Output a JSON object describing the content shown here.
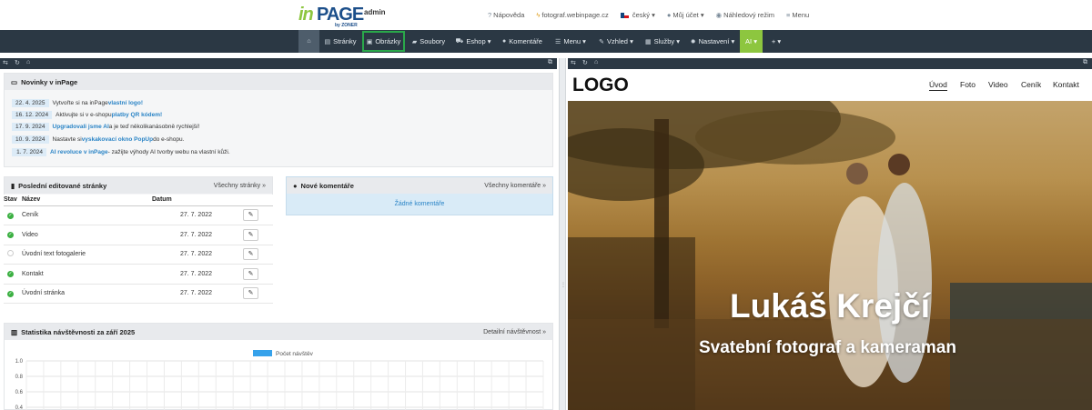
{
  "header": {
    "logo_in": "in",
    "logo_page": "PAGE",
    "logo_by": "by ZONER",
    "logo_admin": "admin",
    "links": [
      {
        "icon": "help-icon",
        "label": "Nápověda"
      },
      {
        "icon": "bolt-icon",
        "label": "fotograf.webinpage.cz"
      },
      {
        "icon": "flag-cz-icon",
        "label": "český ▾"
      },
      {
        "icon": "user-icon",
        "label": "Můj účet ▾"
      },
      {
        "icon": "eye-icon",
        "label": "Náhledový režim"
      },
      {
        "icon": "menu-icon",
        "label": "Menu"
      }
    ]
  },
  "nav": {
    "items": [
      {
        "label": "",
        "icon": "home-icon"
      },
      {
        "label": "Stránky",
        "icon": "page-icon"
      },
      {
        "label": "Obrázky",
        "icon": "image-icon"
      },
      {
        "label": "Soubory",
        "icon": "folder-icon"
      },
      {
        "label": "Eshop ▾",
        "icon": "cart-icon"
      },
      {
        "label": "Komentáře",
        "icon": "comment-icon"
      },
      {
        "label": "Menu ▾",
        "icon": "list-icon"
      },
      {
        "label": "Vzhled ▾",
        "icon": "brush-icon"
      },
      {
        "label": "Služby ▾",
        "icon": "grid-icon"
      },
      {
        "label": "Nastavení ▾",
        "icon": "gear-icon"
      },
      {
        "label": "AI ▾",
        "icon": ""
      },
      {
        "label": "+ ▾",
        "icon": ""
      }
    ],
    "colors": {
      "bar": "#2b3844",
      "active": "#4e5d6b",
      "ai": "#8dc63f",
      "highlight": "#2aa84a"
    }
  },
  "news": {
    "title": "Novinky v inPage",
    "items": [
      {
        "date": "22. 4. 2025",
        "pre": "Vytvořte si na inPage ",
        "bold": "vlastní logo!",
        "post": ""
      },
      {
        "date": "16. 12. 2024",
        "pre": "Aktivujte si v e-shopu ",
        "bold": "platby QR kódem!",
        "post": ""
      },
      {
        "date": "17. 9. 2024",
        "pre": "",
        "bold": "Upgradovali jsme AI",
        "post": " a je teď několikanásobně rychlejší!"
      },
      {
        "date": "10. 9. 2024",
        "pre": "Nastavte si ",
        "bold": "vyskakovací okno PopUp",
        "post": " do e-shopu."
      },
      {
        "date": "1. 7. 2024",
        "pre": "",
        "bold": "AI revoluce v inPage",
        "post": " - zažijte výhody AI tvorby webu na vlastní kůži."
      }
    ]
  },
  "pages": {
    "title": "Poslední editované stránky",
    "all_link": "Všechny stránky »",
    "col_status": "Stav",
    "col_name": "Název",
    "col_date": "Datum",
    "rows": [
      {
        "ok": true,
        "name": "Ceník",
        "date": "27. 7. 2022"
      },
      {
        "ok": true,
        "name": "Video",
        "date": "27. 7. 2022"
      },
      {
        "ok": false,
        "name": "Úvodní text fotogalerie",
        "date": "27. 7. 2022"
      },
      {
        "ok": true,
        "name": "Kontakt",
        "date": "27. 7. 2022"
      },
      {
        "ok": true,
        "name": "Úvodní stránka",
        "date": "27. 7. 2022"
      }
    ]
  },
  "comments": {
    "title": "Nové komentáře",
    "all_link": "Všechny komentáře »",
    "empty": "Žádné komentáře"
  },
  "stats": {
    "title": "Statistika návštěvnosti za září 2025",
    "detail_link": "Detailní návštěvnost »",
    "legend": "Počet návštěv",
    "legend_color": "#36a2eb",
    "ticks": [
      "1.0",
      "0.8",
      "0.6",
      "0.4"
    ]
  },
  "chart_data": {
    "type": "line",
    "series": [
      {
        "name": "Počet návštěv",
        "values": []
      }
    ],
    "ylim": [
      0,
      1
    ],
    "grid": true,
    "legend": "top"
  },
  "site": {
    "logo": "LOGO",
    "menu": [
      "Úvod",
      "Foto",
      "Video",
      "Ceník",
      "Kontakt"
    ],
    "headline": "Lukáš Krejčí",
    "subline": "Svatební fotograf a kameraman"
  }
}
